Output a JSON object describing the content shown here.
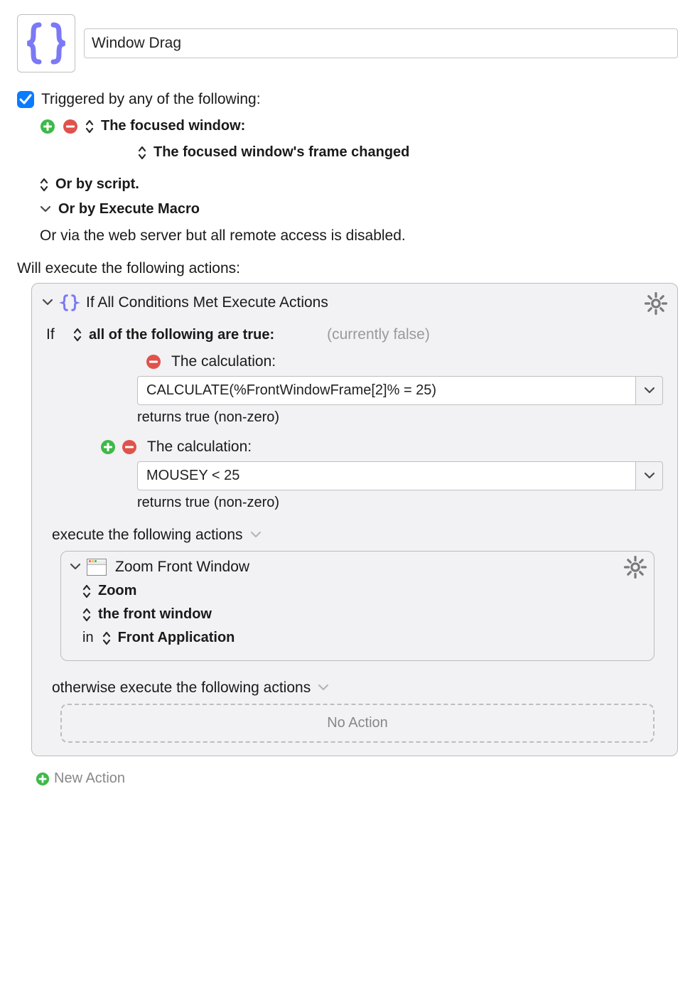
{
  "header": {
    "title": "Window Drag"
  },
  "triggers": {
    "checkbox_checked": true,
    "heading": "Triggered by any of the following:",
    "primary": "The focused window:",
    "primary_detail": "The focused window's frame changed",
    "or_script": "Or by script.",
    "or_execute": "Or by Execute Macro",
    "or_web": "Or via the web server but all remote access is disabled."
  },
  "actions_heading": "Will execute the following actions:",
  "if_action": {
    "title": "If All Conditions Met Execute Actions",
    "if_prefix": "If",
    "qualifier": "all of the following are true:",
    "status": "(currently false)",
    "conditions": [
      {
        "label": "The calculation:",
        "value": "CALCULATE(%FrontWindowFrame[2]% = 25)",
        "returns": "returns true (non-zero)",
        "show_plus": false
      },
      {
        "label": "The calculation:",
        "value": "MOUSEY < 25",
        "returns": "returns true (non-zero)",
        "show_plus": true
      }
    ],
    "execute_label": "execute the following actions",
    "zoom_action": {
      "title": "Zoom Front Window",
      "line1": "Zoom",
      "line2": "the front window",
      "line3_prefix": "in",
      "line3": "Front Application"
    },
    "otherwise_label": "otherwise execute the following actions",
    "no_action": "No Action"
  },
  "new_action": "New Action"
}
